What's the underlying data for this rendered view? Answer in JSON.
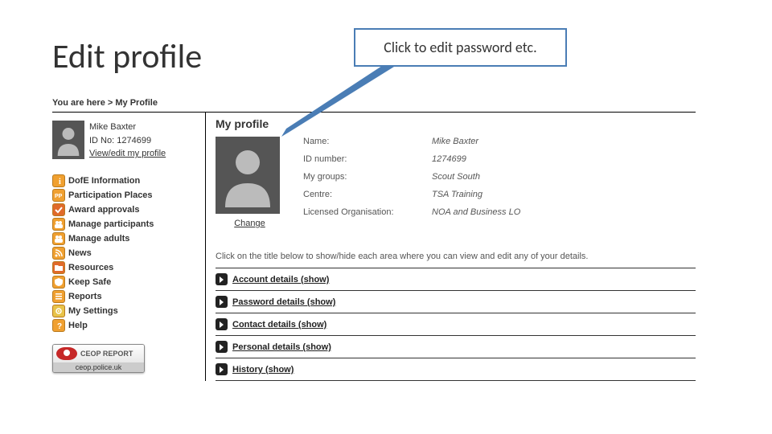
{
  "slide": {
    "title": "Edit profile",
    "callout": "Click to edit password etc."
  },
  "breadcrumb": {
    "prefix": "You are here >",
    "current": "My Profile"
  },
  "user": {
    "name": "Mike Baxter",
    "id_label": "ID No:",
    "id": "1274699",
    "view_edit": "View/edit my profile"
  },
  "nav": [
    {
      "label": "DofE Information",
      "bg": "#f0a030",
      "glyph": "i"
    },
    {
      "label": "Participation Places",
      "bg": "#f0a030",
      "glyph": "pp"
    },
    {
      "label": "Award approvals",
      "bg": "#e06a2a",
      "glyph": "check"
    },
    {
      "label": "Manage participants",
      "bg": "#f0a030",
      "glyph": "people"
    },
    {
      "label": "Manage adults",
      "bg": "#f0a030",
      "glyph": "people"
    },
    {
      "label": "News",
      "bg": "#f0a030",
      "glyph": "rss"
    },
    {
      "label": "Resources",
      "bg": "#e06a2a",
      "glyph": "folder"
    },
    {
      "label": "Keep Safe",
      "bg": "#f0a030",
      "glyph": "shield"
    },
    {
      "label": "Reports",
      "bg": "#f0a030",
      "glyph": "list"
    },
    {
      "label": "My Settings",
      "bg": "#e8c34a",
      "glyph": "gear"
    },
    {
      "label": "Help",
      "bg": "#f0a030",
      "glyph": "q"
    }
  ],
  "ceop": {
    "title": "CEOP REPORT",
    "sub": "ceop.police.uk"
  },
  "profile": {
    "heading": "My profile",
    "change": "Change",
    "fields": {
      "name_l": "Name:",
      "name_v": "Mike Baxter",
      "id_l": "ID number:",
      "id_v": "1274699",
      "groups_l": "My groups:",
      "groups_v": "Scout South",
      "centre_l": "Centre:",
      "centre_v": "TSA Training",
      "org_l": "Licensed Organisation:",
      "org_v": "NOA and Business LO"
    },
    "instruction": "Click on the title below to show/hide each area where you can view and edit any of your details.",
    "sections": [
      "Account details (show)",
      "Password details (show)",
      "Contact details (show)",
      "Personal details (show)",
      "History (show)"
    ]
  }
}
